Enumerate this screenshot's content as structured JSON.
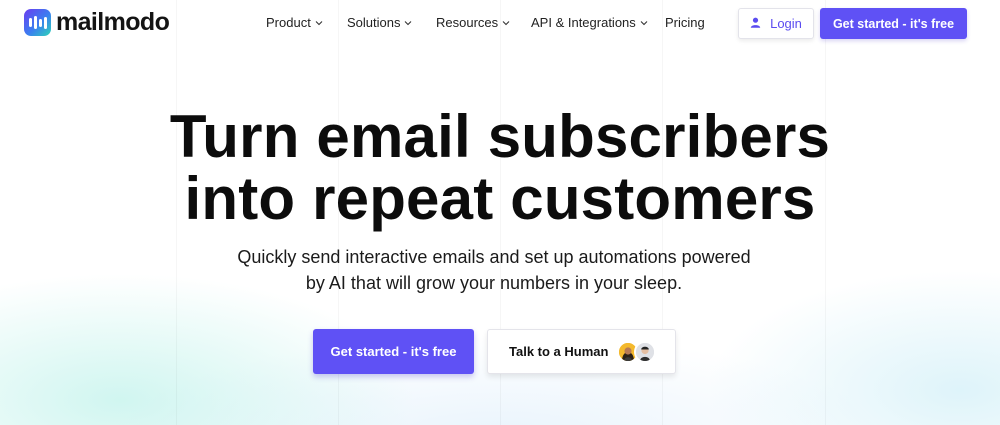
{
  "brand": {
    "name": "mailmodo",
    "icon": "mailmodo-logo-icon"
  },
  "nav": {
    "items": [
      {
        "label": "Product",
        "has_dropdown": true
      },
      {
        "label": "Solutions",
        "has_dropdown": true
      },
      {
        "label": "Resources",
        "has_dropdown": true
      },
      {
        "label": "API & Integrations",
        "has_dropdown": true
      },
      {
        "label": "Pricing",
        "has_dropdown": false
      }
    ],
    "login_label": "Login",
    "login_icon": "user-icon",
    "cta_label": "Get started - it's free"
  },
  "hero": {
    "headline_line1": "Turn email subscribers",
    "headline_line2": "into repeat customers",
    "subtitle_line1": "Quickly send interactive emails and set up automations powered",
    "subtitle_line2": "by AI that will grow your numbers in your sleep.",
    "primary_cta": "Get started - it's free",
    "secondary_cta": "Talk to a Human",
    "secondary_cta_icons": [
      "person-avatar-woman",
      "person-avatar-man"
    ]
  },
  "colors": {
    "accent": "#5f51f5",
    "text": "#0c0c0c",
    "login_text": "#5b4cf0"
  }
}
